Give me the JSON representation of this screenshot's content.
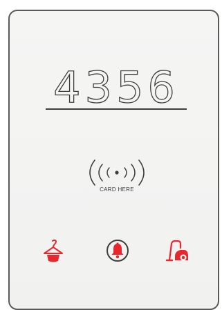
{
  "panel": {
    "room_number": "4356",
    "card_reader": {
      "label": "CARD HERE",
      "icon": "contactless-card-reader-icon"
    },
    "indicators": [
      {
        "name": "housekeeping",
        "icon": "hanger-icon"
      },
      {
        "name": "doorbell",
        "icon": "bell-icon"
      },
      {
        "name": "cleaning",
        "icon": "vacuum-cleaner-icon"
      }
    ]
  },
  "colors": {
    "panel_background": "#f2f2f1",
    "panel_border": "#5a5a5a",
    "text": "#3d3d3d",
    "accent": "#e8262b"
  }
}
